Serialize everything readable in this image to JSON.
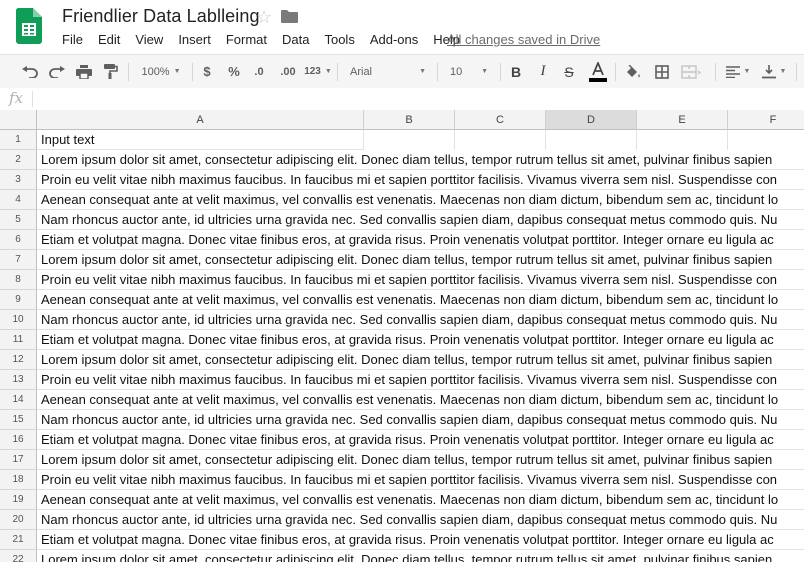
{
  "doc": {
    "title": "Friendlier Data Lablleing",
    "saved_status": "All changes saved in Drive"
  },
  "menu": [
    "File",
    "Edit",
    "View",
    "Insert",
    "Format",
    "Data",
    "Tools",
    "Add-ons",
    "Help"
  ],
  "toolbar": {
    "zoom": "100%",
    "currency": "$",
    "percent": "%",
    "decrease_decimals": ".0",
    "increase_decimals": ".00",
    "more_formats": "123",
    "font": "Arial",
    "font_size": "10"
  },
  "formula_bar": {
    "label": "fx",
    "value": ""
  },
  "columns": [
    "A",
    "B",
    "C",
    "D",
    "E",
    "F"
  ],
  "selected_column": "D",
  "rows": [
    {
      "n": "1",
      "text": "Input text"
    },
    {
      "n": "2",
      "text": "Lorem ipsum dolor sit amet, consectetur adipiscing elit. Donec diam tellus, tempor rutrum tellus sit amet, pulvinar finibus sapien"
    },
    {
      "n": "3",
      "text": "Proin eu velit vitae nibh maximus faucibus. In faucibus mi et sapien porttitor facilisis. Vivamus viverra sem nisl. Suspendisse con"
    },
    {
      "n": "4",
      "text": "Aenean consequat ante at velit maximus, vel convallis est venenatis. Maecenas non diam dictum, bibendum sem ac, tincidunt lo"
    },
    {
      "n": "5",
      "text": "Nam rhoncus auctor ante, id ultricies urna gravida nec. Sed convallis sapien diam, dapibus consequat metus commodo quis. Nu"
    },
    {
      "n": "6",
      "text": "Etiam et volutpat magna. Donec vitae finibus eros, at gravida risus. Proin venenatis volutpat porttitor. Integer ornare eu ligula ac"
    },
    {
      "n": "7",
      "text": "Lorem ipsum dolor sit amet, consectetur adipiscing elit. Donec diam tellus, tempor rutrum tellus sit amet, pulvinar finibus sapien"
    },
    {
      "n": "8",
      "text": "Proin eu velit vitae nibh maximus faucibus. In faucibus mi et sapien porttitor facilisis. Vivamus viverra sem nisl. Suspendisse con"
    },
    {
      "n": "9",
      "text": "Aenean consequat ante at velit maximus, vel convallis est venenatis. Maecenas non diam dictum, bibendum sem ac, tincidunt lo"
    },
    {
      "n": "10",
      "text": "Nam rhoncus auctor ante, id ultricies urna gravida nec. Sed convallis sapien diam, dapibus consequat metus commodo quis. Nu"
    },
    {
      "n": "11",
      "text": "Etiam et volutpat magna. Donec vitae finibus eros, at gravida risus. Proin venenatis volutpat porttitor. Integer ornare eu ligula ac"
    },
    {
      "n": "12",
      "text": "Lorem ipsum dolor sit amet, consectetur adipiscing elit. Donec diam tellus, tempor rutrum tellus sit amet, pulvinar finibus sapien"
    },
    {
      "n": "13",
      "text": "Proin eu velit vitae nibh maximus faucibus. In faucibus mi et sapien porttitor facilisis. Vivamus viverra sem nisl. Suspendisse con"
    },
    {
      "n": "14",
      "text": "Aenean consequat ante at velit maximus, vel convallis est venenatis. Maecenas non diam dictum, bibendum sem ac, tincidunt lo"
    },
    {
      "n": "15",
      "text": "Nam rhoncus auctor ante, id ultricies urna gravida nec. Sed convallis sapien diam, dapibus consequat metus commodo quis. Nu"
    },
    {
      "n": "16",
      "text": "Etiam et volutpat magna. Donec vitae finibus eros, at gravida risus. Proin venenatis volutpat porttitor. Integer ornare eu ligula ac"
    },
    {
      "n": "17",
      "text": "Lorem ipsum dolor sit amet, consectetur adipiscing elit. Donec diam tellus, tempor rutrum tellus sit amet, pulvinar finibus sapien"
    },
    {
      "n": "18",
      "text": "Proin eu velit vitae nibh maximus faucibus. In faucibus mi et sapien porttitor facilisis. Vivamus viverra sem nisl. Suspendisse con"
    },
    {
      "n": "19",
      "text": "Aenean consequat ante at velit maximus, vel convallis est venenatis. Maecenas non diam dictum, bibendum sem ac, tincidunt lo"
    },
    {
      "n": "20",
      "text": "Nam rhoncus auctor ante, id ultricies urna gravida nec. Sed convallis sapien diam, dapibus consequat metus commodo quis. Nu"
    },
    {
      "n": "21",
      "text": "Etiam et volutpat magna. Donec vitae finibus eros, at gravida risus. Proin venenatis volutpat porttitor. Integer ornare eu ligula ac"
    },
    {
      "n": "22",
      "text": "Lorem ipsum dolor sit amet, consectetur adipiscing elit. Donec diam tellus, tempor rutrum tellus sit amet, pulvinar finibus sapien"
    }
  ],
  "colors": {
    "sheets_green": "#0f9d58",
    "header_bg": "#f3f3f3",
    "selected_col_bg": "#dcdcdc",
    "text_color_bar": "#000000"
  },
  "icons": [
    "sheets-logo-icon",
    "star-icon",
    "folder-icon",
    "undo-icon",
    "redo-icon",
    "print-icon",
    "paint-format-icon",
    "bold-icon",
    "italic-icon",
    "strikethrough-icon",
    "text-color-icon",
    "fill-color-icon",
    "borders-icon",
    "merge-cells-icon",
    "align-left-icon",
    "valign-bottom-icon"
  ]
}
